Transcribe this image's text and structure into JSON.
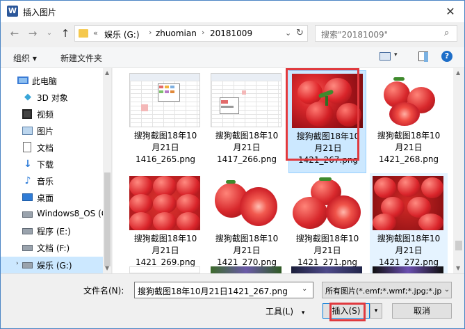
{
  "window": {
    "title": "插入图片",
    "app_icon": "W"
  },
  "address": {
    "overflow": "«",
    "crumbs": [
      "娱乐 (G:)",
      "zhuomian",
      "20181009"
    ],
    "refresh": "↻"
  },
  "search": {
    "placeholder": "搜索\"20181009\""
  },
  "toolbar": {
    "organize": "组织 ▾",
    "new_folder": "新建文件夹"
  },
  "sidebar": {
    "items": [
      {
        "label": "此电脑",
        "icon": "computer-icon"
      },
      {
        "label": "3D 对象",
        "icon": "cube-3d-icon"
      },
      {
        "label": "视频",
        "icon": "video-icon"
      },
      {
        "label": "图片",
        "icon": "picture-icon"
      },
      {
        "label": "文档",
        "icon": "document-icon"
      },
      {
        "label": "下载",
        "icon": "download-icon"
      },
      {
        "label": "音乐",
        "icon": "music-icon"
      },
      {
        "label": "桌面",
        "icon": "desktop-icon"
      },
      {
        "label": "Windows8_OS (C",
        "icon": "drive-icon"
      },
      {
        "label": "程序 (E:)",
        "icon": "drive-icon"
      },
      {
        "label": "文档 (F:)",
        "icon": "drive-icon"
      },
      {
        "label": "娱乐 (G:)",
        "icon": "drive-icon"
      }
    ]
  },
  "files": [
    {
      "name": "搜狗截图18年10月21日1416_265.png",
      "l1": "搜狗截图18年10",
      "l2": "月21日",
      "l3": "1416_265.png",
      "kind": "spreadsheet"
    },
    {
      "name": "搜狗截图18年10月21日1417_266.png",
      "l1": "搜狗截图18年10",
      "l2": "月21日",
      "l3": "1417_266.png",
      "kind": "spreadsheet"
    },
    {
      "name": "搜狗截图18年10月21日1421_267.png",
      "l1": "搜狗截图18年10",
      "l2": "月21日",
      "l3": "1421_267.png",
      "kind": "tomato",
      "selected": true
    },
    {
      "name": "搜狗截图18年10月21日1421_268.png",
      "l1": "搜狗截图18年10",
      "l2": "月21日",
      "l3": "1421_268.png",
      "kind": "tomato-white"
    },
    {
      "name": "搜狗截图18年10月21日1421_269.png",
      "l1": "搜狗截图18年10",
      "l2": "月21日",
      "l3": "1421_269.png",
      "kind": "tomato-white"
    },
    {
      "name": "搜狗截图18年10月21日1421_270.png",
      "l1": "搜狗截图18年10",
      "l2": "月21日",
      "l3": "1421_270.png",
      "kind": "tomato-white"
    },
    {
      "name": "搜狗截图18年10月21日1421_271.png",
      "l1": "搜狗截图18年10",
      "l2": "月21日",
      "l3": "1421_271.png",
      "kind": "tomato-white"
    },
    {
      "name": "搜狗截图18年10月21日1421_272.png",
      "l1": "搜狗截图18年10",
      "l2": "月21日",
      "l3": "1421_272.png",
      "kind": "tomato",
      "hover": true
    }
  ],
  "bottom": {
    "filename_label": "文件名(N):",
    "filename_value": "搜狗截图18年10月21日1421_267.png",
    "filetype_value": "所有图片(*.emf;*.wmf;*.jpg;*.jp",
    "tools": "工具(L)",
    "insert": "插入(S)",
    "cancel": "取消"
  },
  "colors": {
    "accent": "#0078d7",
    "selection": "#cce8ff",
    "highlight_box": "#e0393e",
    "tomato": "#d8282c"
  }
}
